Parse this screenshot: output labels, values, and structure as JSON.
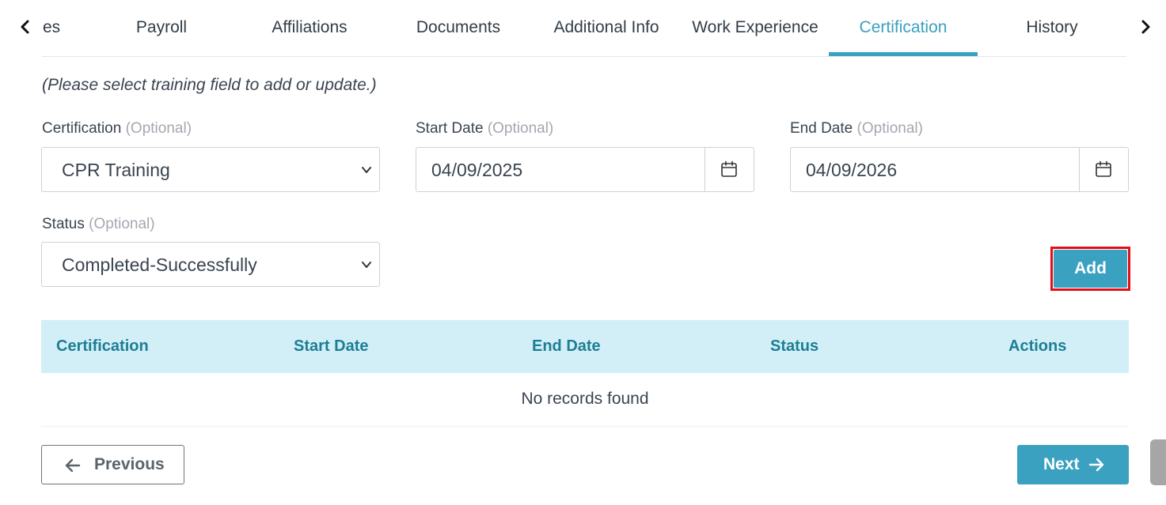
{
  "tabs": {
    "items": [
      {
        "label": "es"
      },
      {
        "label": "Payroll"
      },
      {
        "label": "Affiliations"
      },
      {
        "label": "Documents"
      },
      {
        "label": "Additional Info"
      },
      {
        "label": "Work Experience"
      },
      {
        "label": "Certification",
        "active": true
      },
      {
        "label": "History"
      }
    ],
    "prev_icon": "chevron-left-icon",
    "next_icon": "chevron-right-icon"
  },
  "form": {
    "hint": "(Please select training field to add or update.)",
    "certification": {
      "label": "Certification",
      "optional": "(Optional)",
      "value": "CPR Training"
    },
    "start_date": {
      "label": "Start Date",
      "optional": "(Optional)",
      "value": "04/09/2025"
    },
    "end_date": {
      "label": "End Date",
      "optional": "(Optional)",
      "value": "04/09/2026"
    },
    "status": {
      "label": "Status",
      "optional": "(Optional)",
      "value": "Completed-Successfully"
    },
    "add_label": "Add",
    "add_highlight_color": "#e30e17"
  },
  "table": {
    "columns": [
      "Certification",
      "Start Date",
      "End Date",
      "Status",
      "Actions"
    ],
    "empty_text": "No records found"
  },
  "footer": {
    "previous_label": "Previous",
    "next_label": "Next"
  },
  "colors": {
    "accent": "#3aa1c1",
    "table_header_bg": "#d2eff8",
    "table_header_text": "#1d7e93"
  }
}
